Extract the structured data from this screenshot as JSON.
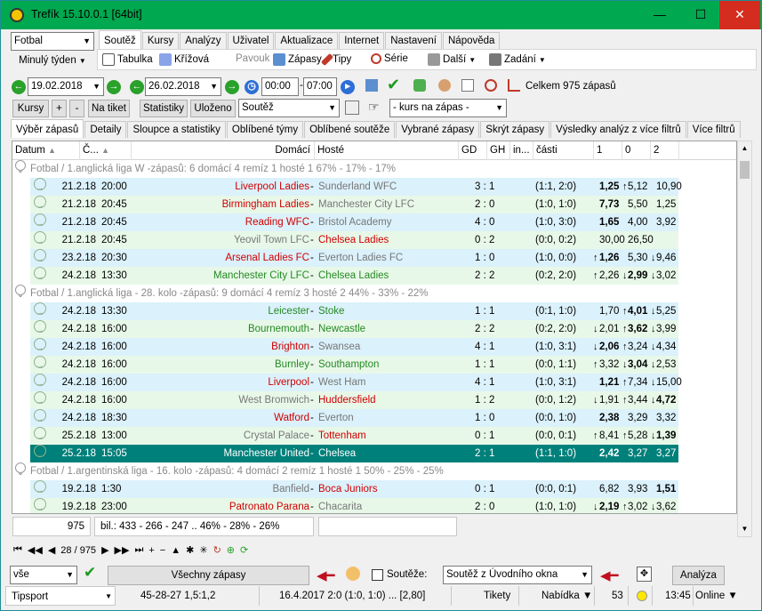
{
  "window": {
    "title": "Trefík 15.10.0.1 [64bit]",
    "min": "—",
    "max": "☐",
    "close": "✕"
  },
  "sport": {
    "value": "Fotbal"
  },
  "period": {
    "value": "Minulý týden"
  },
  "main_tabs": [
    "Soutěž",
    "Kursy",
    "Analýzy",
    "Uživatel",
    "Aktualizace",
    "Internet",
    "Nastavení",
    "Nápověda"
  ],
  "toolbar": {
    "tabulka": "Tabulka",
    "krizova": "Křížová",
    "pavouk": "Pavouk",
    "zapasy": "Zápasy",
    "tipy": "Tipy",
    "serie": "Série",
    "dalsi": "Další",
    "zadani": "Zadání"
  },
  "dates": {
    "from": "19.02.2018",
    "to": "26.02.2018",
    "time_from": "00:00",
    "time_to": "07:00",
    "count": "Celkem 975 zápasů"
  },
  "filters": {
    "kursy": "Kursy",
    "plus": "+",
    "minus": "-",
    "na_tiket": "Na tiket",
    "statistiky": "Statistiky",
    "ulozeno": "Uloženo",
    "soutez": "Soutěž",
    "kurs": "- kurs na zápas -"
  },
  "sub_tabs": [
    "Výběr zápasů",
    "Detaily",
    "Sloupce a statistiky",
    "Oblíbené týmy",
    "Oblíbené soutěže",
    "Vybrané zápasy",
    "Skrýt zápasy",
    "Výsledky analýz z více filtrů",
    "Více filtrů"
  ],
  "columns": {
    "datum": "Datum",
    "cas": "Č...",
    "domaci": "Domácí",
    "hoste": "Hosté",
    "gd": "GD",
    "gh": "GH",
    "in": "in...",
    "casti": "části",
    "o1": "1",
    "o0": "0",
    "o2": "2"
  },
  "groups": [
    {
      "label": "Fotbal / 1.anglická liga W -zápasů: 6  domácí 4  remíz 1  hosté 1     67% - 17% - 17%"
    },
    {
      "label": "Fotbal / 1.anglická liga - 28. kolo -zápasů: 9  domácí 4  remíz 3  hosté 2     44% - 33% - 22%"
    },
    {
      "label": "Fotbal / 1.argentinská liga - 16. kolo -zápasů: 4  domácí 2  remíz 1  hosté 1     50% - 25% - 25%"
    }
  ],
  "matches": [
    {
      "d": "21.2.18",
      "t": "20:00",
      "home": "Liverpool Ladies",
      "away": "Sunderland WFC",
      "score": "3 : 1",
      "parts": "(1:1, 2:0)",
      "o1": "1,25",
      "o0": "5,12",
      "o2": "10,90",
      "hc": "red",
      "ac": "gray",
      "b": "o1",
      "a1": "",
      "a0": "↑",
      "a2": ""
    },
    {
      "d": "21.2.18",
      "t": "20:45",
      "home": "Birmingham Ladies",
      "away": "Manchester City LFC",
      "score": "2 : 0",
      "parts": "(1:0, 1:0)",
      "o1": "7,73",
      "o0": "5,50",
      "o2": "1,25",
      "hc": "red",
      "ac": "gray",
      "b": "o1",
      "a1": "",
      "a0": "",
      "a2": ""
    },
    {
      "d": "21.2.18",
      "t": "20:45",
      "home": "Reading WFC",
      "away": "Bristol Academy",
      "score": "4 : 0",
      "parts": "(1:0, 3:0)",
      "o1": "1,65",
      "o0": "4,00",
      "o2": "3,92",
      "hc": "red",
      "ac": "gray",
      "b": "o1",
      "a1": "",
      "a0": "",
      "a2": ""
    },
    {
      "d": "21.2.18",
      "t": "20:45",
      "home": "Yeovil Town LFC",
      "away": "Chelsea Ladies",
      "score": "0 : 2",
      "parts": "(0:0, 0:2)",
      "o1": "30,00",
      "o0": "26,50",
      "o2": "",
      "hc": "gray",
      "ac": "red",
      "b": "",
      "a1": "",
      "a0": "",
      "a2": ""
    },
    {
      "d": "23.2.18",
      "t": "20:30",
      "home": "Arsenal Ladies FC",
      "away": "Everton Ladies FC",
      "score": "1 : 0",
      "parts": "(1:0, 0:0)",
      "o1": "1,26",
      "o0": "5,30",
      "o2": "9,46",
      "hc": "red",
      "ac": "gray",
      "b": "o1",
      "a1": "↑",
      "a0": "",
      "a2": "↓"
    },
    {
      "d": "24.2.18",
      "t": "13:30",
      "home": "Manchester City LFC",
      "away": "Chelsea Ladies",
      "score": "2 : 2",
      "parts": "(0:2, 2:0)",
      "o1": "2,26",
      "o0": "2,99",
      "o2": "3,02",
      "hc": "green",
      "ac": "green",
      "b": "o0",
      "a1": "↑",
      "a0": "↓",
      "a2": "↓"
    },
    {
      "d": "24.2.18",
      "t": "13:30",
      "home": "Leicester",
      "away": "Stoke",
      "score": "1 : 1",
      "parts": "(0:1, 1:0)",
      "o1": "1,70",
      "o0": "4,01",
      "o2": "5,25",
      "hc": "green",
      "ac": "green",
      "b": "o0",
      "a1": "",
      "a0": "↑",
      "a2": "↓"
    },
    {
      "d": "24.2.18",
      "t": "16:00",
      "home": "Bournemouth",
      "away": "Newcastle",
      "score": "2 : 2",
      "parts": "(0:2, 2:0)",
      "o1": "2,01",
      "o0": "3,62",
      "o2": "3,99",
      "hc": "green",
      "ac": "green",
      "b": "o0",
      "a1": "↓",
      "a0": "↑",
      "a2": "↓"
    },
    {
      "d": "24.2.18",
      "t": "16:00",
      "home": "Brighton",
      "away": "Swansea",
      "score": "4 : 1",
      "parts": "(1:0, 3:1)",
      "o1": "2,06",
      "o0": "3,24",
      "o2": "4,34",
      "hc": "red",
      "ac": "gray",
      "b": "o1",
      "a1": "↓",
      "a0": "↑",
      "a2": "↓"
    },
    {
      "d": "24.2.18",
      "t": "16:00",
      "home": "Burnley",
      "away": "Southampton",
      "score": "1 : 1",
      "parts": "(0:0, 1:1)",
      "o1": "3,32",
      "o0": "3,04",
      "o2": "2,53",
      "hc": "green",
      "ac": "green",
      "b": "o0",
      "a1": "↑",
      "a0": "↓",
      "a2": "↓"
    },
    {
      "d": "24.2.18",
      "t": "16:00",
      "home": "Liverpool",
      "away": "West Ham",
      "score": "4 : 1",
      "parts": "(1:0, 3:1)",
      "o1": "1,21",
      "o0": "7,34",
      "o2": "15,00",
      "hc": "red",
      "ac": "gray",
      "b": "o1",
      "a1": "",
      "a0": "↑",
      "a2": "↓"
    },
    {
      "d": "24.2.18",
      "t": "16:00",
      "home": "West Bromwich",
      "away": "Huddersfield",
      "score": "1 : 2",
      "parts": "(0:0, 1:2)",
      "o1": "1,91",
      "o0": "3,44",
      "o2": "4,72",
      "hc": "gray",
      "ac": "red",
      "b": "o2",
      "a1": "↓",
      "a0": "↑",
      "a2": "↓"
    },
    {
      "d": "24.2.18",
      "t": "18:30",
      "home": "Watford",
      "away": "Everton",
      "score": "1 : 0",
      "parts": "(0:0, 1:0)",
      "o1": "2,38",
      "o0": "3,29",
      "o2": "3,32",
      "hc": "red",
      "ac": "gray",
      "b": "o1",
      "a1": "",
      "a0": "",
      "a2": ""
    },
    {
      "d": "25.2.18",
      "t": "13:00",
      "home": "Crystal Palace",
      "away": "Tottenham",
      "score": "0 : 1",
      "parts": "(0:0, 0:1)",
      "o1": "8,41",
      "o0": "5,28",
      "o2": "1,39",
      "hc": "gray",
      "ac": "red",
      "b": "o2",
      "a1": "↑",
      "a0": "↑",
      "a2": "↓"
    },
    {
      "d": "25.2.18",
      "t": "15:05",
      "home": "Manchester United",
      "away": "Chelsea",
      "score": "2 : 1",
      "parts": "(1:1, 1:0)",
      "o1": "2,42",
      "o0": "3,27",
      "o2": "3,27",
      "hc": "sel",
      "ac": "sel",
      "b": "o1",
      "a1": "",
      "a0": "",
      "a2": ""
    },
    {
      "d": "19.2.18",
      "t": "1:30",
      "home": "Banfield",
      "away": "Boca Juniors",
      "score": "0 : 1",
      "parts": "(0:0, 0:1)",
      "o1": "6,82",
      "o0": "3,93",
      "o2": "1,51",
      "hc": "gray",
      "ac": "red",
      "b": "o2",
      "a1": "",
      "a0": "",
      "a2": ""
    },
    {
      "d": "19.2.18",
      "t": "23:00",
      "home": "Patronato Parana",
      "away": "Chacarita",
      "score": "2 : 0",
      "parts": "(1:0, 1:0)",
      "o1": "2,19",
      "o0": "3,02",
      "o2": "3,62",
      "hc": "red",
      "ac": "gray",
      "b": "o1",
      "a1": "↓",
      "a0": "↑",
      "a2": "↓"
    }
  ],
  "summary": {
    "count": "975",
    "stats": "bil.: 433 - 266 - 247 .. 46% - 28% - 26%"
  },
  "nav": {
    "pos": "28 / 975"
  },
  "bottom": {
    "filter": "vše",
    "all_btn": "Všechny zápasy",
    "soutez_chk": "Soutěže:",
    "soutez_sel": "Soutěž z Úvodního okna",
    "analyza": "Analýza"
  },
  "statusbar": {
    "bookie": "Tipsport",
    "stat": "45-28-27  1,5:1,2",
    "last": "16.4.2017 2:0 (1:0, 1:0) ... [2,80]",
    "tikety": "Tikety",
    "nabidka": "Nabídka ▼",
    "num": "53",
    "time": "13:45",
    "online": "Online ▼"
  }
}
